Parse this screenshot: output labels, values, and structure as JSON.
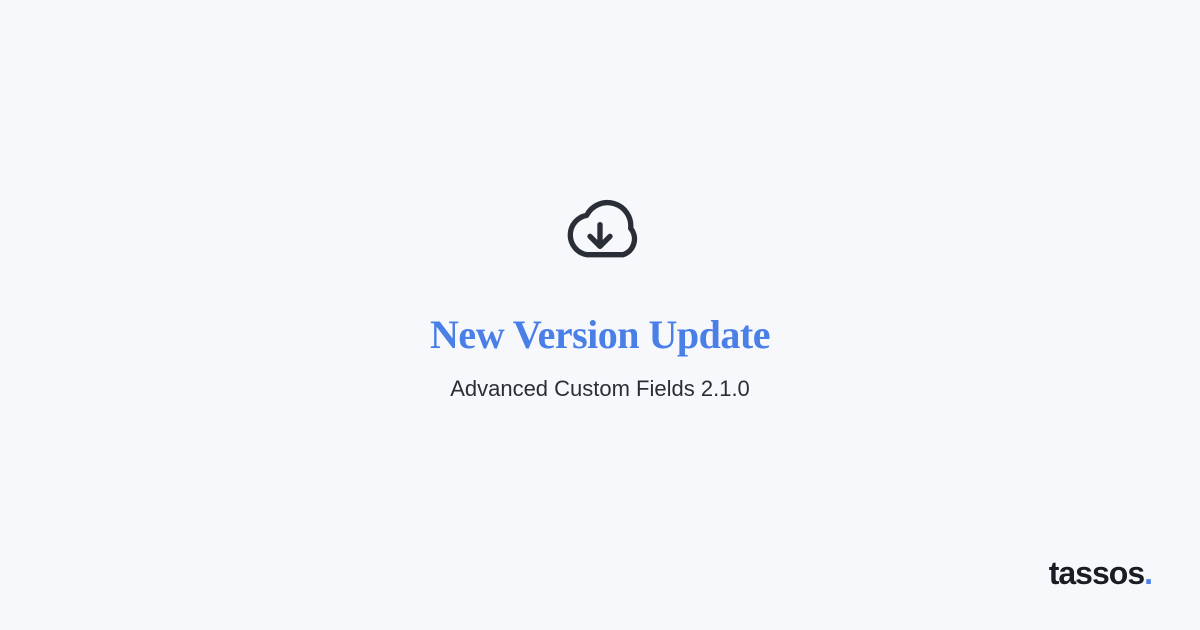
{
  "main": {
    "title": "New Version Update",
    "subtitle": "Advanced Custom Fields 2.1.0"
  },
  "branding": {
    "logo_text": "tassos",
    "logo_dot": "."
  },
  "colors": {
    "accent": "#4a7fe8",
    "text_dark": "#2a2e37",
    "icon": "#2a2e37",
    "background": "#f7f8fc"
  }
}
